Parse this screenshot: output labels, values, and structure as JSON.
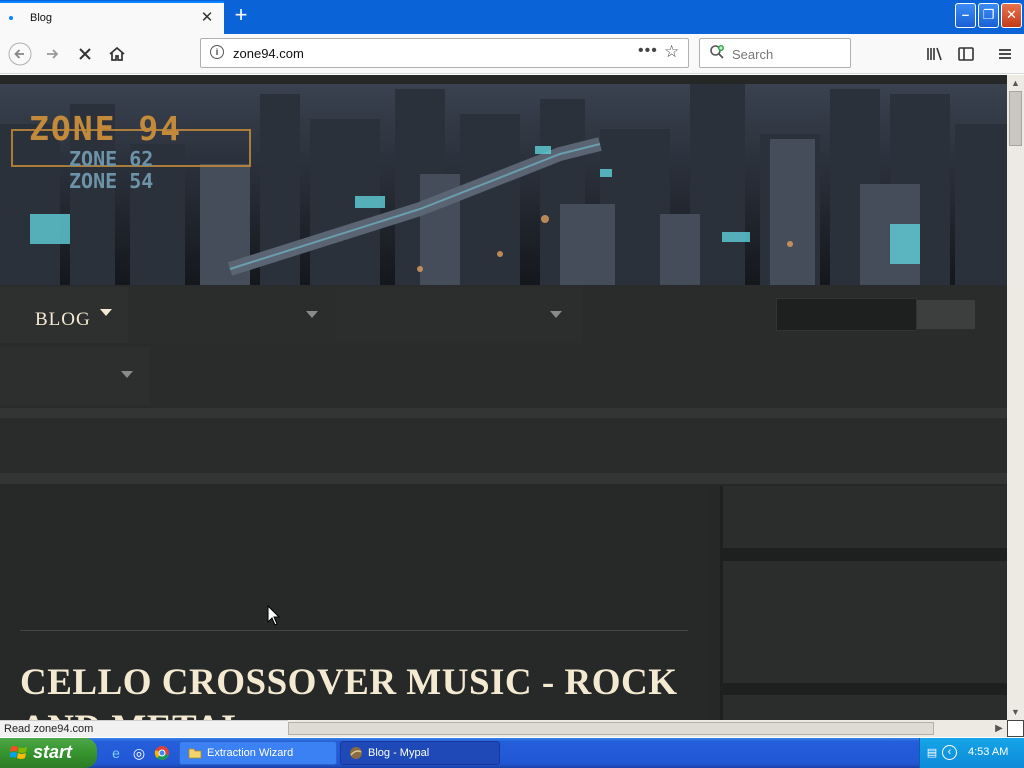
{
  "browser": {
    "tab_title": "Blog",
    "tab_close": "✕",
    "new_tab": "+",
    "url": "zone94.com",
    "url_actions": "•••",
    "bookmark_star": "☆",
    "search_placeholder": "Search",
    "window_minimize": "–",
    "window_maximize": "❐",
    "window_close": "✕",
    "status_text": "Read zone94.com"
  },
  "site": {
    "logo_main": "ZONE 94",
    "logo_sub1": "ZONE 62",
    "logo_sub2": "ZONE 54",
    "menu_blog": "BLOG",
    "post_title": "CELLO CROSSOVER MUSIC - ROCK AND METAL"
  },
  "taskbar": {
    "start_label": "start",
    "task_1": "Extraction Wizard",
    "task_2": "Blog - Mypal",
    "clock": "4:53 AM"
  },
  "colors": {
    "accent_browser": "#0a84ff",
    "page_bg": "#262727",
    "heading_cream": "#f4ead2",
    "logo_gold": "#c28a3a",
    "xp_blue": "#245edb",
    "xp_green": "#37962f"
  }
}
